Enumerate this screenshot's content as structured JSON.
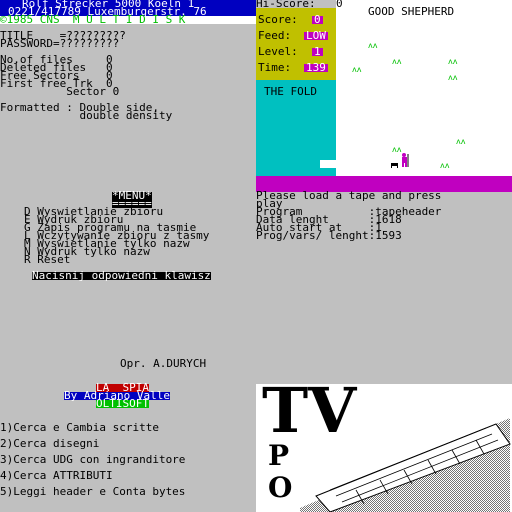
{
  "header": {
    "line1": "Rolf Strecker 5000 Koeln 1",
    "line2": "0221/417789 Luxemburgerstr. 76",
    "line3": "©1985 CNS  M U L T I D I S K"
  },
  "disk_info": {
    "title_line": "TITLE    =?????????",
    "password_line": "PASSWORD=?????????",
    "stats": [
      "No.of files     0",
      "Deleted files   0",
      "Free Sectors    0",
      "First free Trk  0",
      "          Sector 0"
    ],
    "formatted_1": "Formatted : Double side,",
    "formatted_2": "            double density"
  },
  "game": {
    "hiscore_label": "Hi-Score:",
    "hiscore_value": "0",
    "title": "GOOD SHEPHERD",
    "score_label": "Score:",
    "score_value": "0",
    "feed_label": "Feed:",
    "feed_value": "LOW",
    "level_label": "Level:",
    "level_value": "1",
    "time_label": "Time:",
    "time_value": "139",
    "fold_label": "THE FOLD"
  },
  "loader": {
    "line1": "Please load a tape and press",
    "line2": "play",
    "rows": [
      "Program          :tapeheader",
      "Data lenght      :1618",
      "Auto start at    :1",
      "Prog/vars/ lenght:1593"
    ]
  },
  "menu": {
    "title": "*MENU*",
    "underline": "======",
    "items": [
      "D Wyswietlanie zbioru",
      "E Wydruk zbioru",
      "G Zapis programu na tasmie",
      "L Wczytywanie zbioru z tasmy",
      "M Wyswietlanie tylko nazw",
      "N Wydruk tylko nazw",
      "R Reset"
    ],
    "prompt": "Nacisnij odpowiedni klawisz",
    "author": "Opr. A.DURYCH"
  },
  "spia": {
    "title": "LA  SPIA",
    "by": "By Adriano Valle",
    "publisher": "OLTISOFT",
    "options": [
      "1)Cerca e Cambia scritte",
      "2)Cerca disegni",
      "3)Cerca UDG con ingranditore",
      "4)Cerca ATTRIBUTI",
      "5)Leggi header e Conta bytes"
    ]
  },
  "tvart": {
    "big_text": "TV",
    "letters": [
      "P",
      "O"
    ]
  },
  "colors": {
    "spectrum_blue": "#0000c0",
    "spectrum_yellow": "#c0c000",
    "spectrum_cyan": "#00c0c0",
    "spectrum_magenta": "#c000c0",
    "spectrum_red": "#c00000",
    "spectrum_green": "#00c000",
    "spectrum_grey": "#c0c0c0"
  }
}
